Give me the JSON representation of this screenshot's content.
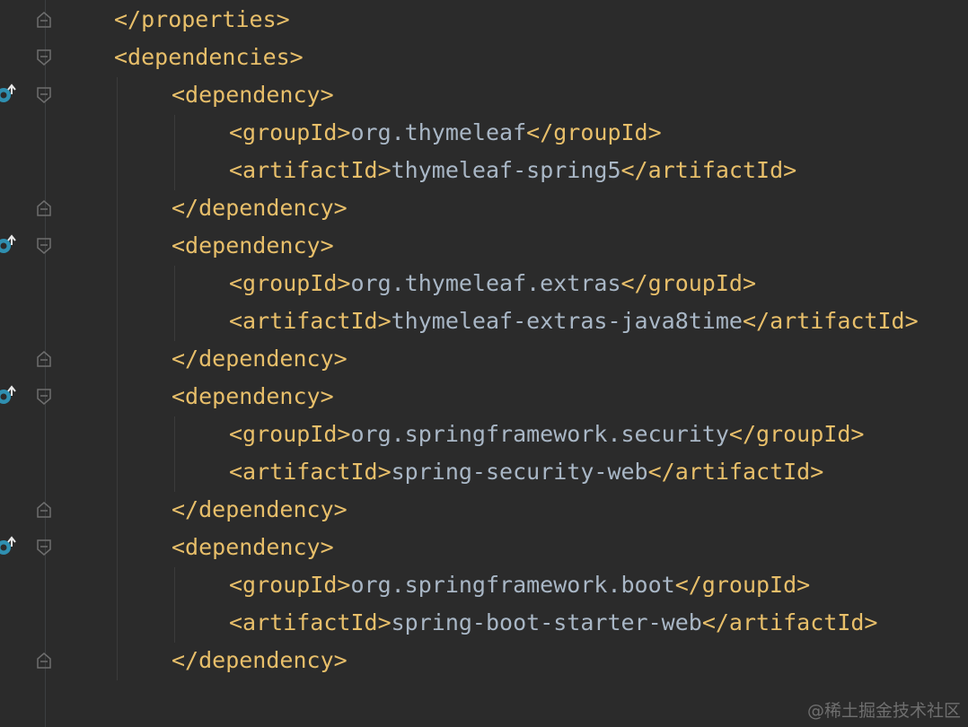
{
  "editor": {
    "lines": [
      {
        "open": "</properties>",
        "text": "",
        "close": ""
      },
      {
        "open": "<dependencies>",
        "text": "",
        "close": ""
      },
      {
        "open": "<dependency>",
        "text": "",
        "close": ""
      },
      {
        "open": "<groupId>",
        "text": "org.thymeleaf",
        "close": "</groupId>"
      },
      {
        "open": "<artifactId>",
        "text": "thymeleaf-spring5",
        "close": "</artifactId>"
      },
      {
        "open": "</dependency>",
        "text": "",
        "close": ""
      },
      {
        "open": "<dependency>",
        "text": "",
        "close": ""
      },
      {
        "open": "<groupId>",
        "text": "org.thymeleaf.extras",
        "close": "</groupId>"
      },
      {
        "open": "<artifactId>",
        "text": "thymeleaf-extras-java8time",
        "close": "</artifactId>"
      },
      {
        "open": "</dependency>",
        "text": "",
        "close": ""
      },
      {
        "open": "<dependency>",
        "text": "",
        "close": ""
      },
      {
        "open": "<groupId>",
        "text": "org.springframework.security",
        "close": "</groupId>"
      },
      {
        "open": "<artifactId>",
        "text": "spring-security-web",
        "close": "</artifactId>"
      },
      {
        "open": "</dependency>",
        "text": "",
        "close": ""
      },
      {
        "open": "<dependency>",
        "text": "",
        "close": ""
      },
      {
        "open": "<groupId>",
        "text": "org.springframework.boot",
        "close": "</groupId>"
      },
      {
        "open": "<artifactId>",
        "text": "spring-boot-starter-web",
        "close": "</artifactId>"
      },
      {
        "open": "</dependency>",
        "text": "",
        "close": ""
      }
    ]
  },
  "gutter": {
    "dependency_icon": "maven-dependency-icon",
    "fold_icon": "fold-marker-icon"
  },
  "colors": {
    "background": "#2b2b2b",
    "tag": "#e8bf6a",
    "text": "#a9b7c6"
  },
  "watermark": "@稀土掘金技术社区"
}
